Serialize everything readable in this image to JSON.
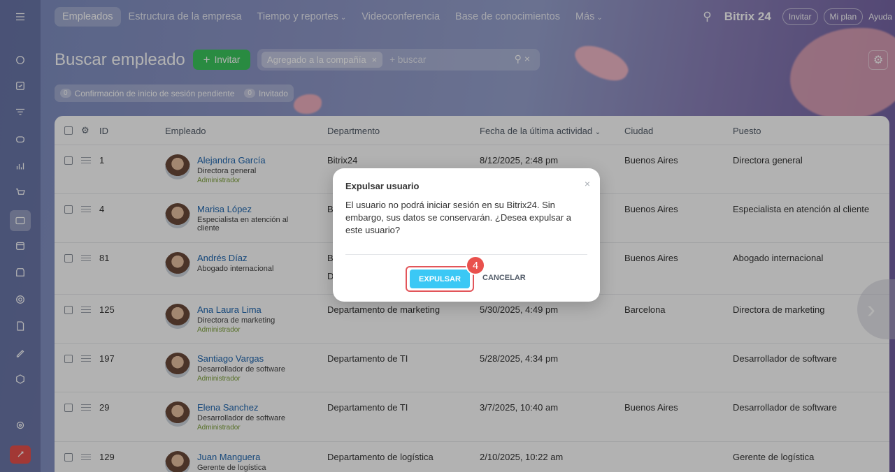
{
  "nav": {
    "items": [
      {
        "label": "Empleados",
        "active": true,
        "dropdown": false
      },
      {
        "label": "Estructura de la empresa",
        "active": false,
        "dropdown": false
      },
      {
        "label": "Tiempo y reportes",
        "active": false,
        "dropdown": true
      },
      {
        "label": "Videoconferencia",
        "active": false,
        "dropdown": false
      },
      {
        "label": "Base de conocimientos",
        "active": false,
        "dropdown": false
      },
      {
        "label": "Más",
        "active": false,
        "dropdown": true
      }
    ]
  },
  "header": {
    "brand": "Bitrix 24",
    "invite": "Invitar",
    "plan": "Mi plan",
    "help": "Ayuda"
  },
  "page": {
    "title": "Buscar empleado",
    "invite_button": "Invitar"
  },
  "search": {
    "chip": "Agregado a la compañía",
    "placeholder": "+ buscar"
  },
  "counters": [
    {
      "count": "0",
      "label": "Confirmación de inicio de sesión pendiente"
    },
    {
      "count": "0",
      "label": "Invitado"
    }
  ],
  "table": {
    "headers": {
      "id": "ID",
      "employee": "Empleado",
      "department": "Departmento",
      "activity": "Fecha de la última actividad",
      "city": "Ciudad",
      "position": "Puesto"
    },
    "rows": [
      {
        "id": "1",
        "name": "Alejandra García",
        "position": "Directora general",
        "role": "Administrador",
        "department": "Bitrix24",
        "activity": "8/12/2025, 2:48 pm",
        "city": "Buenos Aires",
        "job": "Directora general"
      },
      {
        "id": "4",
        "name": "Marisa López",
        "position": "Especialista en atención al cliente",
        "role": "",
        "department": "B",
        "activity": "",
        "city": "Buenos Aires",
        "job": "Especialista en atención al cliente"
      },
      {
        "id": "81",
        "name": "Andrés Díaz",
        "position": "Abogado internacional",
        "role": "",
        "department": "B",
        "department2": "D",
        "activity": "",
        "city": "Buenos Aires",
        "job": "Abogado internacional"
      },
      {
        "id": "125",
        "name": "Ana Laura Lima",
        "position": "Directora de marketing",
        "role": "Administrador",
        "department": "Departamento de marketing",
        "activity": "5/30/2025, 4:49 pm",
        "city": "Barcelona",
        "job": "Directora de marketing"
      },
      {
        "id": "197",
        "name": "Santiago Vargas",
        "position": "Desarrollador de software",
        "role": "Administrador",
        "department": "Departamento de TI",
        "activity": "5/28/2025, 4:34 pm",
        "city": "",
        "job": "Desarrollador de software"
      },
      {
        "id": "29",
        "name": "Elena Sanchez",
        "position": "Desarrollador de software",
        "role": "Administrador",
        "department": "Departamento de TI",
        "activity": "3/7/2025, 10:40 am",
        "city": "Buenos Aires",
        "job": "Desarrollador de software"
      },
      {
        "id": "129",
        "name": "Juan Manguera",
        "position": "Gerente de logística",
        "role": "",
        "department": "Departamento de logística",
        "activity": "2/10/2025, 10:22 am",
        "city": "",
        "job": "Gerente de logística"
      }
    ]
  },
  "dialog": {
    "title": "Expulsar usuario",
    "body": "El usuario no podrá iniciar sesión en su Bitrix24. Sin embargo, sus datos se conservarán. ¿Desea expulsar a este usuario?",
    "confirm": "EXPULSAR",
    "cancel": "CANCELAR"
  },
  "step_badge": "4",
  "colors": {
    "accent": "#3bc8f5",
    "invite_green": "#3bc85e",
    "badge_red": "#e9514d",
    "link": "#2067b0"
  }
}
